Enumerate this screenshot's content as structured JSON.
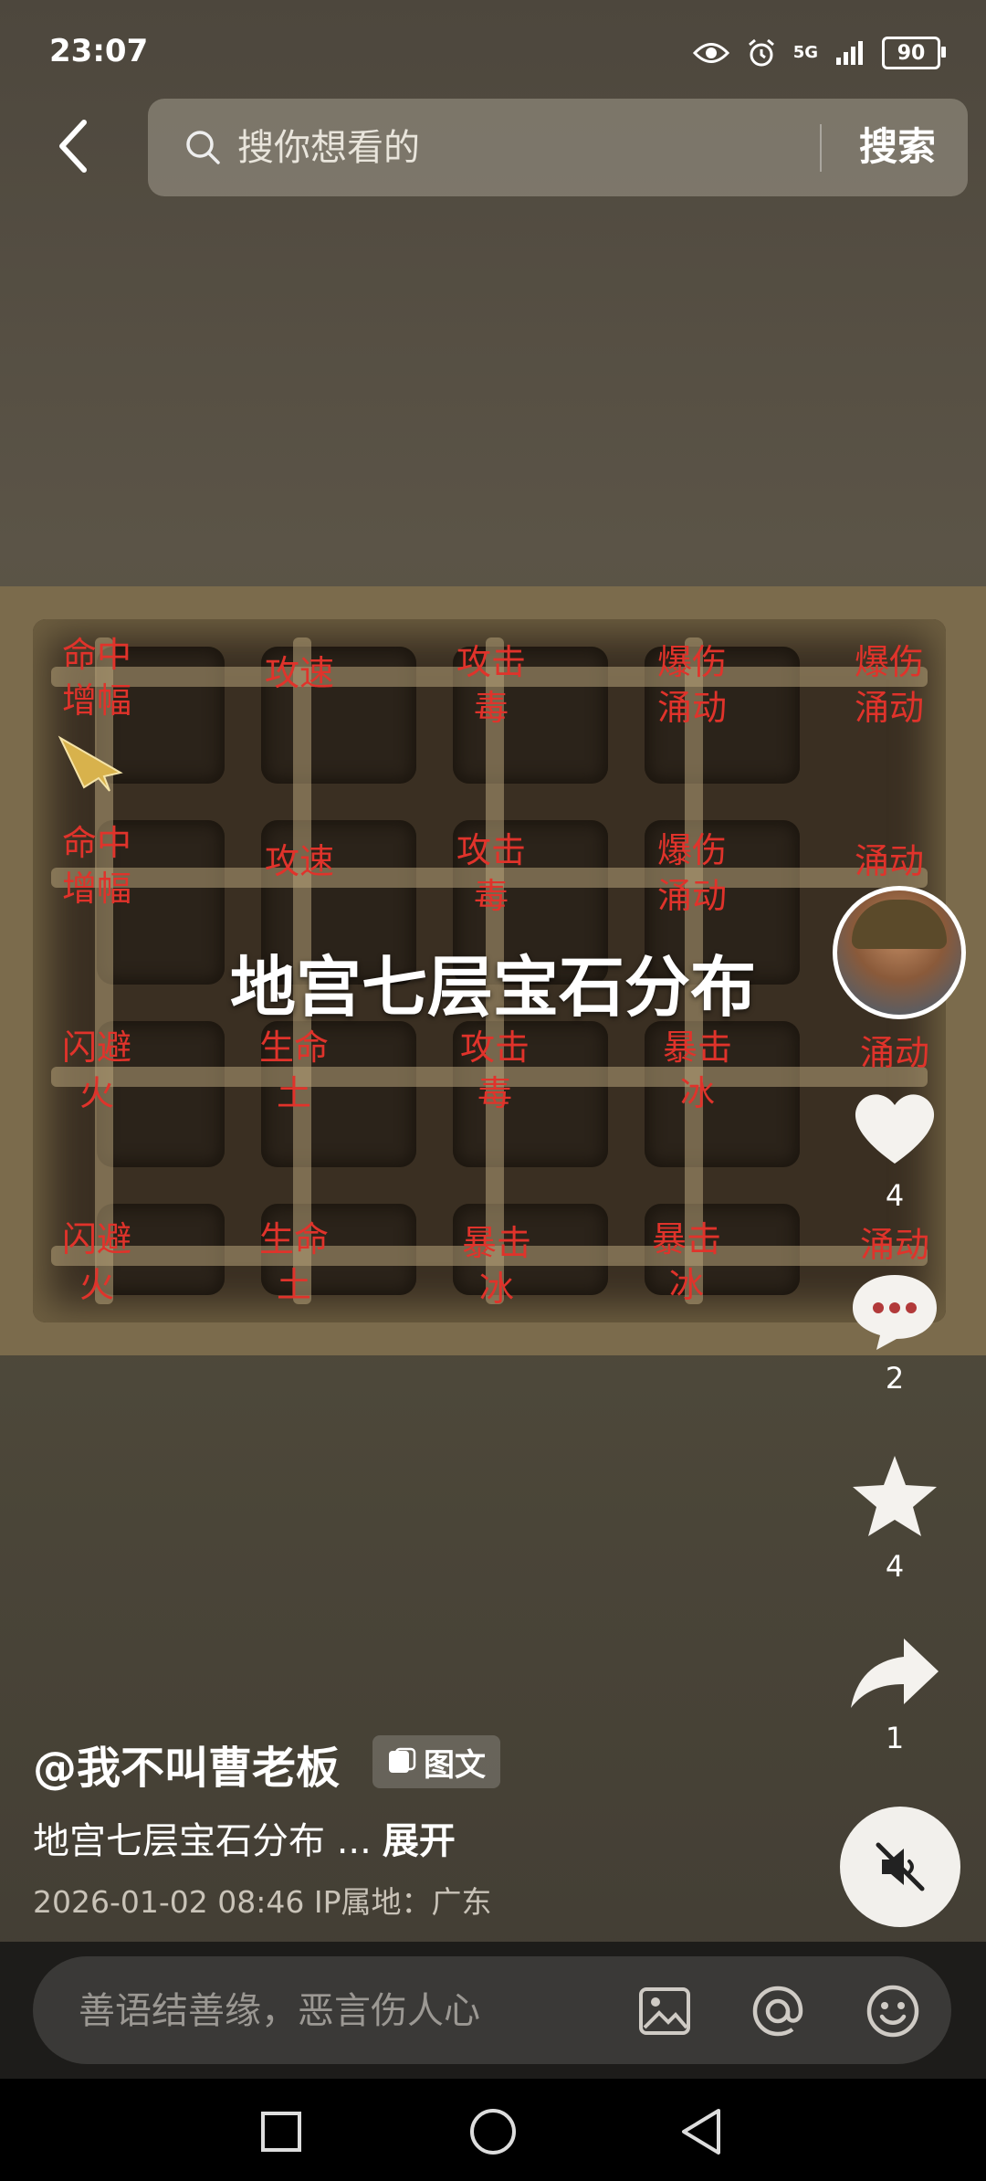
{
  "status_bar": {
    "time": "23:07",
    "network": "5G",
    "battery": "90"
  },
  "search": {
    "placeholder": "搜你想看的",
    "button_label": "搜索"
  },
  "post_image": {
    "title": "地宫七层宝石分布",
    "gem_labels": [
      "命中\n增幅",
      "攻速",
      "攻击\n毒",
      "爆伤\n涌动",
      "爆伤\n涌动",
      "命中\n增幅",
      "攻速",
      "攻击\n毒",
      "爆伤\n涌动",
      "涌动",
      "闪避\n火",
      "生命\n土",
      "攻击\n毒",
      "暴击\n冰",
      "涌动",
      "闪避\n火",
      "生命\n土",
      "暴击\n冰",
      "暴击\n冰",
      "涌动"
    ]
  },
  "actions": {
    "likes": "4",
    "comments": "2",
    "favorites": "4",
    "shares": "1"
  },
  "post": {
    "author": "@我不叫曹老板",
    "tag": "图文",
    "description": "地宫七层宝石分布 ...",
    "expand_label": "展开",
    "meta": "2026-01-02 08:46  IP属地：广东"
  },
  "comment": {
    "placeholder": "善语结善缘，恶言伤人心"
  },
  "icons": {
    "back": "chevron-left-icon",
    "search": "search-icon",
    "like": "heart-icon",
    "comment": "comment-bubble-icon",
    "favorite": "star-icon",
    "share": "share-arrow-icon",
    "mute": "speaker-muted-icon",
    "image": "image-icon",
    "mention": "at-icon",
    "emoji": "smiley-icon"
  },
  "colors": {
    "gem_label": "#e0332b",
    "map_frame": "#7b6b4c",
    "comment_bar": "#1d1c1a"
  }
}
